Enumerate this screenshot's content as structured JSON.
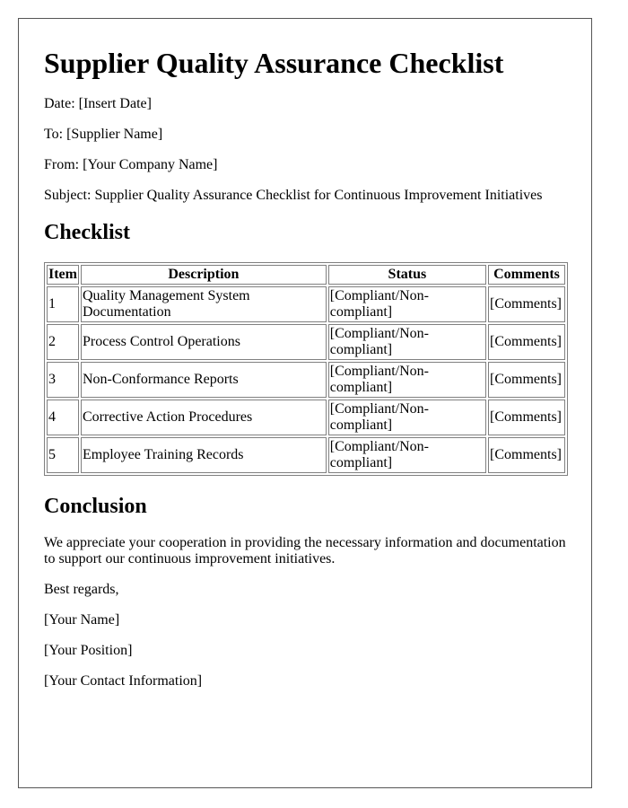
{
  "document": {
    "title": "Supplier Quality Assurance Checklist",
    "meta": {
      "date": "Date: [Insert Date]",
      "to": "To: [Supplier Name]",
      "from": "From: [Your Company Name]",
      "subject": "Subject: Supplier Quality Assurance Checklist for Continuous Improvement Initiatives"
    },
    "checklist": {
      "heading": "Checklist",
      "columns": [
        "Item",
        "Description",
        "Status",
        "Comments"
      ],
      "rows": [
        {
          "item": "1",
          "description": "Quality Management System Documentation",
          "status": "[Compliant/Non-compliant]",
          "comments": "[Comments]"
        },
        {
          "item": "2",
          "description": "Process Control Operations",
          "status": "[Compliant/Non-compliant]",
          "comments": "[Comments]"
        },
        {
          "item": "3",
          "description": "Non-Conformance Reports",
          "status": "[Compliant/Non-compliant]",
          "comments": "[Comments]"
        },
        {
          "item": "4",
          "description": "Corrective Action Procedures",
          "status": "[Compliant/Non-compliant]",
          "comments": "[Comments]"
        },
        {
          "item": "5",
          "description": "Employee Training Records",
          "status": "[Compliant/Non-compliant]",
          "comments": "[Comments]"
        }
      ]
    },
    "conclusion": {
      "heading": "Conclusion",
      "body": "We appreciate your cooperation in providing the necessary information and documentation to support our continuous improvement initiatives.",
      "closing": "Best regards,",
      "name": "[Your Name]",
      "position": "[Your Position]",
      "contact": "[Your Contact Information]"
    }
  }
}
